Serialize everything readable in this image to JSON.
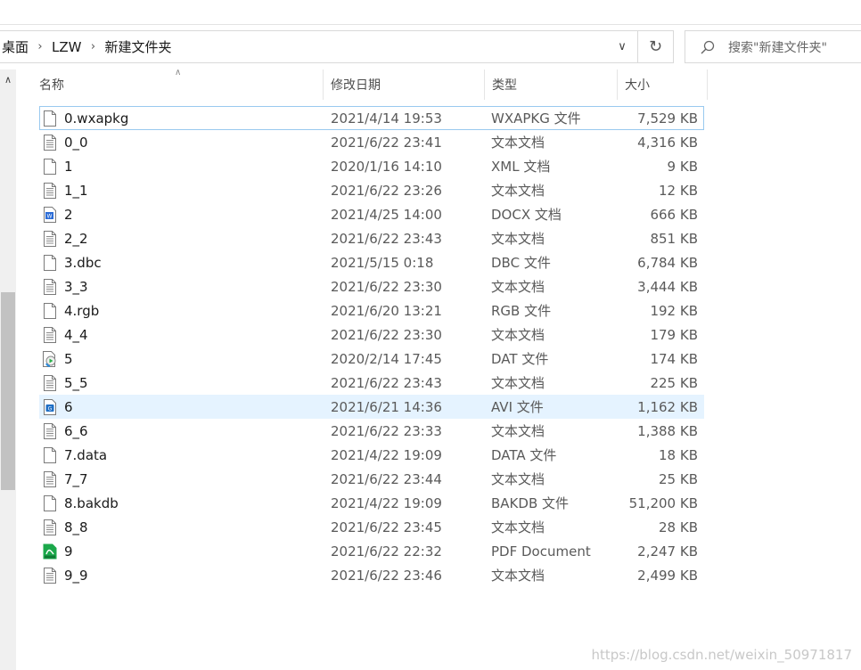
{
  "breadcrumb": [
    "桌面",
    "LZW",
    "新建文件夹"
  ],
  "search": {
    "placeholder": "搜索\"新建文件夹\""
  },
  "columns": {
    "name": "名称",
    "date": "修改日期",
    "type": "类型",
    "size": "大小"
  },
  "files": [
    {
      "name": "0.wxapkg",
      "date": "2021/4/14 19:53",
      "type": "WXAPKG 文件",
      "size": "7,529 KB",
      "icon": "blank-file-icon"
    },
    {
      "name": "0_0",
      "date": "2021/6/22 23:41",
      "type": "文本文档",
      "size": "4,316 KB",
      "icon": "text-file-icon"
    },
    {
      "name": "1",
      "date": "2020/1/16 14:10",
      "type": "XML 文档",
      "size": "9 KB",
      "icon": "blank-file-icon"
    },
    {
      "name": "1_1",
      "date": "2021/6/22 23:26",
      "type": "文本文档",
      "size": "12 KB",
      "icon": "text-file-icon"
    },
    {
      "name": "2",
      "date": "2021/4/25 14:00",
      "type": "DOCX 文档",
      "size": "666 KB",
      "icon": "docx-file-icon"
    },
    {
      "name": "2_2",
      "date": "2021/6/22 23:43",
      "type": "文本文档",
      "size": "851 KB",
      "icon": "text-file-icon"
    },
    {
      "name": "3.dbc",
      "date": "2021/5/15 0:18",
      "type": "DBC 文件",
      "size": "6,784 KB",
      "icon": "blank-file-icon"
    },
    {
      "name": "3_3",
      "date": "2021/6/22 23:30",
      "type": "文本文档",
      "size": "3,444 KB",
      "icon": "text-file-icon"
    },
    {
      "name": "4.rgb",
      "date": "2021/6/20 13:21",
      "type": "RGB 文件",
      "size": "192 KB",
      "icon": "blank-file-icon"
    },
    {
      "name": "4_4",
      "date": "2021/6/22 23:30",
      "type": "文本文档",
      "size": "179 KB",
      "icon": "text-file-icon"
    },
    {
      "name": "5",
      "date": "2020/2/14 17:45",
      "type": "DAT 文件",
      "size": "174 KB",
      "icon": "media-file-icon"
    },
    {
      "name": "5_5",
      "date": "2021/6/22 23:43",
      "type": "文本文档",
      "size": "225 KB",
      "icon": "text-file-icon"
    },
    {
      "name": "6",
      "date": "2021/6/21 14:36",
      "type": "AVI 文件",
      "size": "1,162 KB",
      "icon": "video-file-icon"
    },
    {
      "name": "6_6",
      "date": "2021/6/22 23:33",
      "type": "文本文档",
      "size": "1,388 KB",
      "icon": "text-file-icon"
    },
    {
      "name": "7.data",
      "date": "2021/4/22 19:09",
      "type": "DATA 文件",
      "size": "18 KB",
      "icon": "blank-file-icon"
    },
    {
      "name": "7_7",
      "date": "2021/6/22 23:44",
      "type": "文本文档",
      "size": "25 KB",
      "icon": "text-file-icon"
    },
    {
      "name": "8.bakdb",
      "date": "2021/4/22 19:09",
      "type": "BAKDB 文件",
      "size": "51,200 KB",
      "icon": "blank-file-icon"
    },
    {
      "name": "8_8",
      "date": "2021/6/22 23:45",
      "type": "文本文档",
      "size": "28 KB",
      "icon": "text-file-icon"
    },
    {
      "name": "9",
      "date": "2021/6/22 22:32",
      "type": "PDF Document",
      "size": "2,247 KB",
      "icon": "pdf-file-icon"
    },
    {
      "name": "9_9",
      "date": "2021/6/22 23:46",
      "type": "文本文档",
      "size": "2,499 KB",
      "icon": "text-file-icon"
    }
  ],
  "state": {
    "focused_row": "0.wxapkg",
    "hovered_row": "6"
  },
  "colors": {
    "hover": "#e5f3ff",
    "focus_border": "#99c9ef",
    "pdf_green": "#1ba84b",
    "docx_blue": "#2b6cd6"
  },
  "watermark": "https://blog.csdn.net/weixin_50971817"
}
